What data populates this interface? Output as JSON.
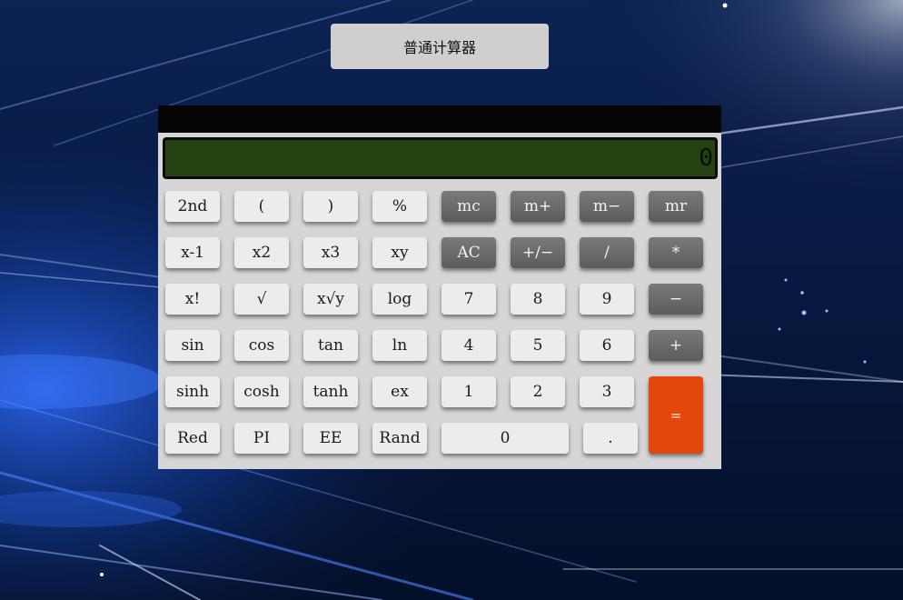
{
  "mode_button": {
    "label": "普通计算器"
  },
  "display": {
    "value": "0"
  },
  "colors": {
    "background": "#06122e",
    "calculator_body": "#d6d6d6",
    "display_bg": "#23420f",
    "light_key": "#ececec",
    "dark_key": "#666666",
    "equals_key": "#e4470c"
  },
  "keys": {
    "second": "2nd",
    "lparen": "(",
    "rparen": ")",
    "percent": "%",
    "mc": "mc",
    "mplus": "m+",
    "mminus": "m−",
    "mr": "mr",
    "x_inverse": "x-1",
    "x_squared": "x2",
    "x_cubed": "x3",
    "x_pow_y": "xy",
    "ac": "AC",
    "plus_minus": "+/−",
    "divide": "/",
    "multiply": "*",
    "factorial": "x!",
    "sqrt": "√",
    "x_root_y": "x√y",
    "log": "log",
    "seven": "7",
    "eight": "8",
    "nine": "9",
    "minus": "−",
    "sin": "sin",
    "cos": "cos",
    "tan": "tan",
    "ln": "ln",
    "four": "4",
    "five": "5",
    "six": "6",
    "plus": "+",
    "sinh": "sinh",
    "cosh": "cosh",
    "tanh": "tanh",
    "ex": "ex",
    "one": "1",
    "two": "2",
    "three": "3",
    "equals": "=",
    "red": "Red",
    "pi": "PI",
    "ee": "EE",
    "rand": "Rand",
    "zero": "0",
    "decimal": "."
  }
}
